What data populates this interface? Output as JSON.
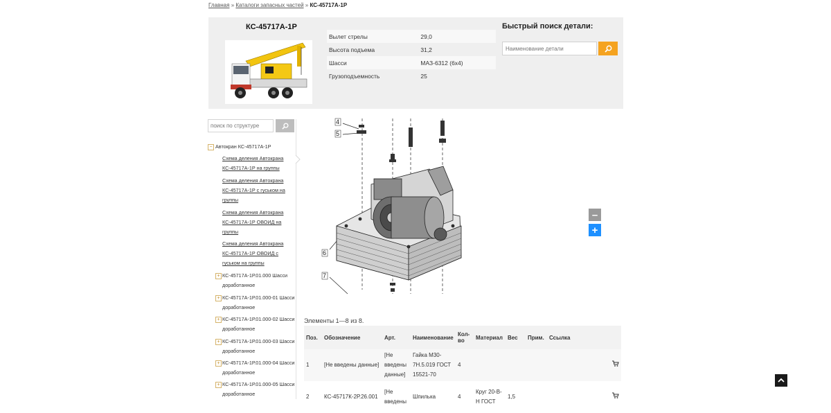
{
  "breadcrumb": {
    "home": "Главная",
    "sep1": "»",
    "catalogs": "Каталоги запасных частей",
    "sep2": "»",
    "current": "КС-45717А-1Р"
  },
  "model": {
    "title": "КС-45717А-1Р",
    "specs": [
      {
        "label": "Вылет стрелы",
        "value": "29,0"
      },
      {
        "label": "Высота подъема",
        "value": "31,2"
      },
      {
        "label": "Шасси",
        "value": "МАЗ-6312 (6x4)"
      },
      {
        "label": "Грузоподъемность",
        "value": "25"
      }
    ]
  },
  "quick_search": {
    "title": "Быстрый поиск детали:",
    "placeholder": "Наименование детали",
    "icon": "search-icon"
  },
  "tree": {
    "search_placeholder": "поиск по структуре",
    "root": "Автокран КС-45717А-1Р",
    "links": [
      "Схема деления Автокрана КС-45717А-1Р на группы",
      "Схема деления Автокрана КС-45717А-1Р с гуськом на группы",
      "Схема деления Автокрана КС-45717А-1Р ОВОИД на группы",
      "Схема деления Автокрана КС-45717А-1Р ОВОИД с гуськом на группы"
    ],
    "nodes": [
      "КС-45717А-1Р.01.000 Шасси доработанное",
      "КС-45717А-1Р.01.000-01 Шасси доработанное",
      "КС-45717А-1Р.01.000-02 Шасси доработанное",
      "КС-45717А-1Р.01.000-03 Шасси доработанное",
      "КС-45717А-1Р.01.000-04 Шасси доработанное",
      "КС-45717А-1Р.01.000-05 Шасси доработанное"
    ]
  },
  "diagram": {
    "callouts": [
      "4",
      "5",
      "6",
      "7"
    ],
    "zoom_out": "–",
    "zoom_in": "+"
  },
  "parts_table": {
    "count_text": "Элементы 1—8 из 8.",
    "headers": [
      "Поз.",
      "Обозначение",
      "Арт.",
      "Наименование",
      "Кол-во",
      "Материал",
      "Вес",
      "Прим.",
      "Ссылка"
    ],
    "rows": [
      {
        "pos": "1",
        "designation": "[Не введены данные]",
        "art": "[Не введены данные]",
        "name": "Гайка М30-7Н.5.019 ГОСТ 15521-70",
        "qty": "4",
        "material": "",
        "weight": "",
        "note": "",
        "link_icon": "cart-icon"
      },
      {
        "pos": "2",
        "designation": "КС-45717К-2Р.26.001",
        "art": "[Не введены",
        "name": "Шпилька",
        "qty": "4",
        "material": "Круг 20-В-Н ГОСТ",
        "weight": "1,5",
        "note": "",
        "link_icon": "cart-icon"
      }
    ]
  },
  "colors": {
    "accent": "#f5a320",
    "zoom_in": "#1e90ff",
    "panel": "#efefef"
  }
}
